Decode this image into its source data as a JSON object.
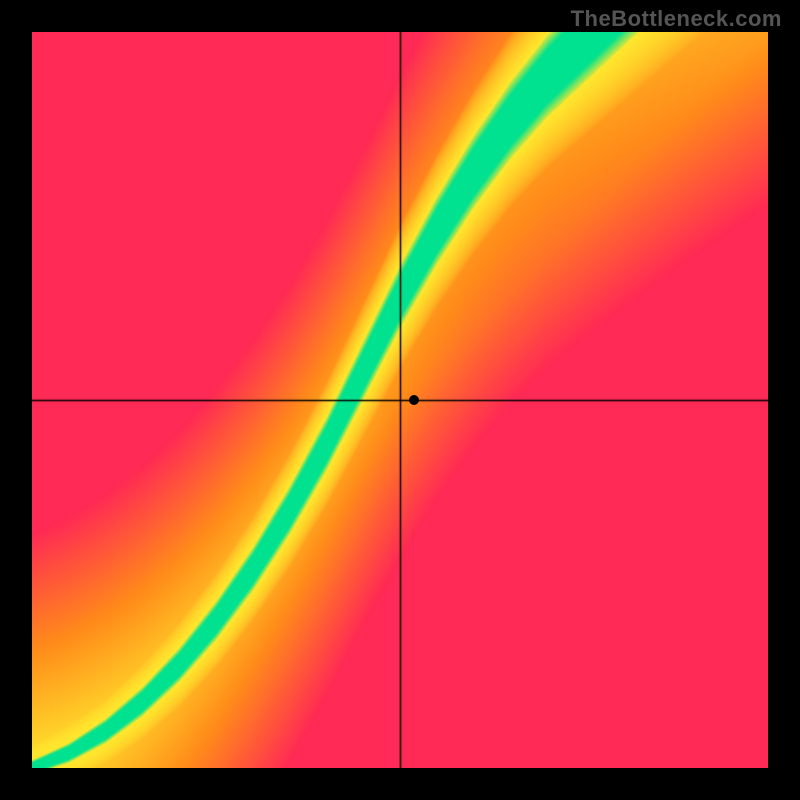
{
  "watermark": "TheBottleneck.com",
  "canvas": {
    "offset_x": 32,
    "offset_y": 32,
    "size": 736
  },
  "colors": {
    "red": "#ff2a55",
    "orange": "#ff8c1a",
    "yellow": "#ffe82e",
    "green": "#00e28f"
  },
  "chart_data": {
    "type": "heatmap",
    "title": "",
    "xlabel": "",
    "ylabel": "",
    "xlim": [
      0,
      1
    ],
    "ylim": [
      0,
      1
    ],
    "axis_cross": {
      "x": 0.5,
      "y": 0.5
    },
    "marker": {
      "x": 0.52,
      "y": 0.5
    },
    "optimal_curve": [
      [
        0.0,
        0.0
      ],
      [
        0.05,
        0.02
      ],
      [
        0.1,
        0.05
      ],
      [
        0.15,
        0.09
      ],
      [
        0.2,
        0.14
      ],
      [
        0.25,
        0.2
      ],
      [
        0.3,
        0.27
      ],
      [
        0.35,
        0.35
      ],
      [
        0.4,
        0.44
      ],
      [
        0.42,
        0.48
      ],
      [
        0.44,
        0.52
      ],
      [
        0.46,
        0.56
      ],
      [
        0.48,
        0.6
      ],
      [
        0.5,
        0.64
      ],
      [
        0.55,
        0.73
      ],
      [
        0.6,
        0.81
      ],
      [
        0.65,
        0.88
      ],
      [
        0.7,
        0.94
      ],
      [
        0.75,
        0.99
      ],
      [
        0.8,
        1.04
      ],
      [
        0.85,
        1.09
      ],
      [
        0.9,
        1.14
      ],
      [
        0.95,
        1.19
      ],
      [
        1.0,
        1.24
      ]
    ],
    "green_halfwidth_start": 0.01,
    "green_halfwidth_end": 0.075,
    "yellow_extra_start": 0.02,
    "yellow_extra_end": 0.09
  }
}
